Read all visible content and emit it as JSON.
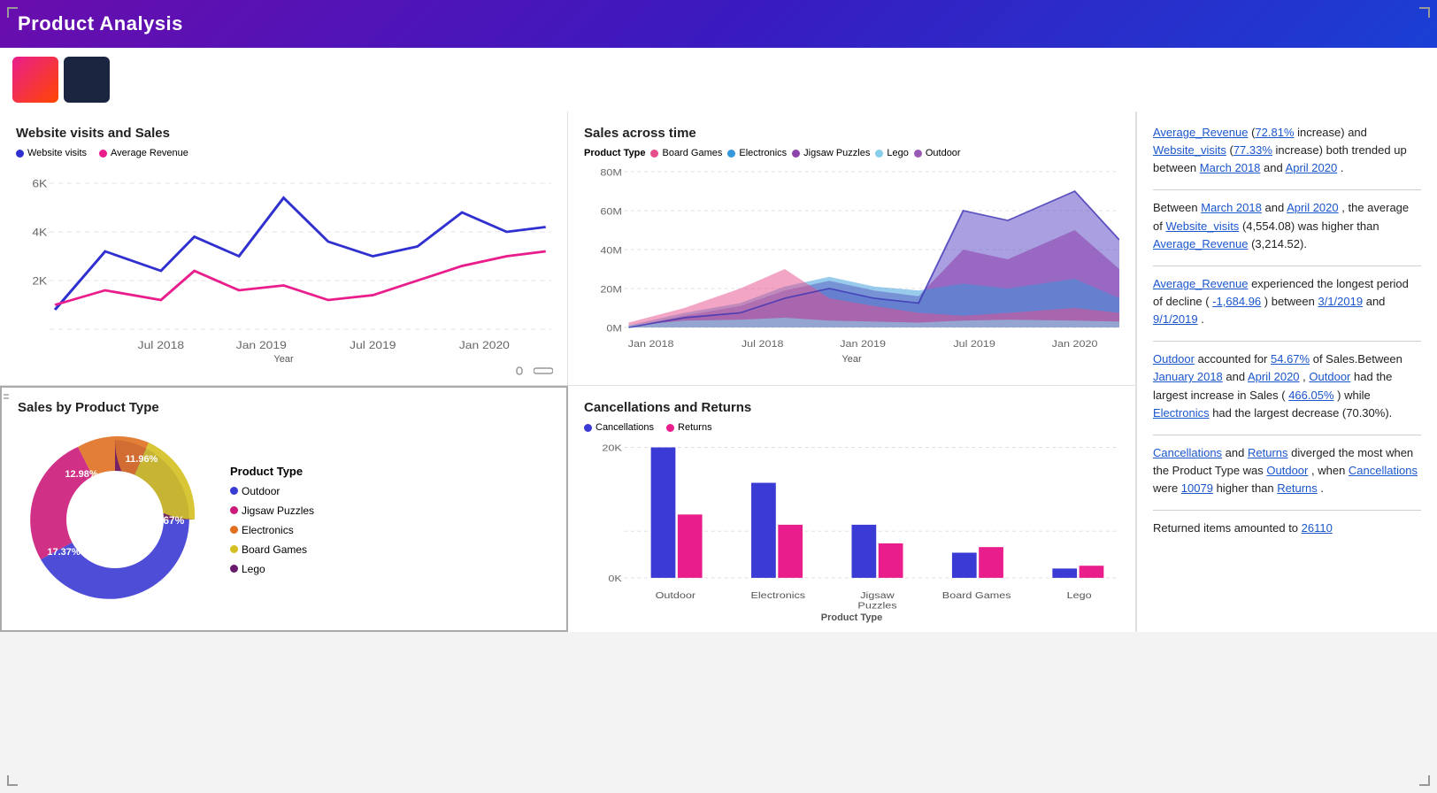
{
  "header": {
    "title": "Product Analysis"
  },
  "insights": {
    "p1": "Average_Revenue (72.81% increase) and Website_visits (77.33% increase) both trended up between March 2018 and April 2020.",
    "p2": "Between March 2018 and April 2020, the average of Website_visits (4,554.08) was higher than Average_Revenue (3,214.52).",
    "p3": "Average_Revenue experienced the longest period of decline (-1,684.96) between 3/1/2019 and 9/1/2019.",
    "p4_pre": "Outdoor accounted for ",
    "p4_pct": "54.67%",
    "p4_mid": " of Sales.Between ",
    "p4_date1": "January 2018",
    "p4_and": " and ",
    "p4_date2": "April 2020",
    "p4_rest": ", Outdoor had the largest increase in Sales (466.05%) while Electronics had the largest decrease (70.30%).",
    "p5": "Cancellations and Returns diverged the most when the Product Type was Outdoor, when Cancellations were 10079 higher than Returns.",
    "p6": "Returned items amounted to 26110"
  },
  "websiteSalesChart": {
    "title": "Website visits and Sales",
    "legend": [
      {
        "label": "Website visits",
        "color": "#3030d0"
      },
      {
        "label": "Average Revenue",
        "color": "#e91e8c"
      }
    ],
    "yLabels": [
      "6K",
      "4K",
      "2K"
    ],
    "xLabels": [
      "Jul 2018",
      "Jan 2019",
      "Jul 2019",
      "Jan 2020"
    ],
    "xAxisLabel": "Year"
  },
  "salesAcrossTime": {
    "title": "Sales across time",
    "legendLabel": "Product Type",
    "legend": [
      {
        "label": "Board Games",
        "color": "#e74c8b"
      },
      {
        "label": "Electronics",
        "color": "#3498db"
      },
      {
        "label": "Jigsaw Puzzles",
        "color": "#8e44ad"
      },
      {
        "label": "Lego",
        "color": "#87ceeb"
      },
      {
        "label": "Outdoor",
        "color": "#9b59b6"
      }
    ],
    "yLabels": [
      "80M",
      "60M",
      "40M",
      "20M",
      "0M"
    ],
    "xLabels": [
      "Jan 2018",
      "Jul 2018",
      "Jan 2019",
      "Jul 2019",
      "Jan 2020"
    ],
    "xAxisLabel": "Year"
  },
  "salesByProduct": {
    "title": "Sales by Product Type",
    "donut": [
      {
        "label": "Outdoor",
        "pct": 54.67,
        "color": "#3a3ad4",
        "textPct": "54.67%",
        "showLabel": true,
        "labelX": 260,
        "labelY": 130
      },
      {
        "label": "Jigsaw Puzzles",
        "pct": 17.37,
        "color": "#cc1a7a",
        "textPct": "17.37%",
        "showLabel": true
      },
      {
        "label": "Electronics",
        "pct": 12.98,
        "color": "#e07020",
        "textPct": "12.98%",
        "showLabel": true
      },
      {
        "label": "Board Games",
        "pct": 11.96,
        "color": "#d4c020",
        "textPct": "11.96%",
        "showLabel": true
      },
      {
        "label": "Lego",
        "pct": 3.0,
        "color": "#6a1a6a",
        "showLabel": false
      }
    ],
    "legendItems": [
      {
        "label": "Outdoor",
        "color": "#3a3ad4"
      },
      {
        "label": "Jigsaw Puzzles",
        "color": "#cc1a7a"
      },
      {
        "label": "Electronics",
        "color": "#e07020"
      },
      {
        "label": "Board Games",
        "color": "#d4c020"
      },
      {
        "label": "Lego",
        "color": "#6a1a6a"
      }
    ]
  },
  "cancellations": {
    "title": "Cancellations and Returns",
    "legend": [
      {
        "label": "Cancellations",
        "color": "#3a3ad4"
      },
      {
        "label": "Returns",
        "color": "#e91e8c"
      }
    ],
    "yLabels": [
      "20K",
      "0K"
    ],
    "categories": [
      "Outdoor",
      "Electronics",
      "Jigsaw\nPuzzles",
      "Board Games",
      "Lego"
    ],
    "xAxisLabel": "Product Type",
    "bars": [
      {
        "cat": "Outdoor",
        "cancel": 0.95,
        "returns": 0.48
      },
      {
        "cat": "Electronics",
        "cancel": 0.72,
        "returns": 0.4
      },
      {
        "cat": "Jigsaw Puzzles",
        "cancel": 0.4,
        "returns": 0.26
      },
      {
        "cat": "Board Games",
        "cancel": 0.18,
        "returns": 0.22
      },
      {
        "cat": "Lego",
        "cancel": 0.07,
        "returns": 0.09
      }
    ]
  }
}
